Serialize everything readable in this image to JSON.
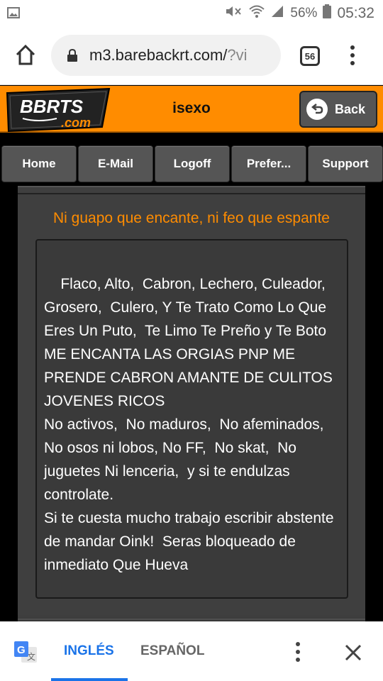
{
  "status_bar": {
    "battery": "56%",
    "time": "05:32",
    "icons": [
      "image-icon",
      "mute-icon",
      "wifi-icon",
      "signal-icon",
      "battery-icon"
    ]
  },
  "browser": {
    "url_main": "m3.barebackrt.com/",
    "url_dim": "?vi",
    "tab_count": "56"
  },
  "site": {
    "logo_text_top": "BBRTS",
    "logo_text_bottom": ".com",
    "page_title": "isexo",
    "back_label": "Back",
    "accent_color": "#ff8c00"
  },
  "nav": {
    "items": [
      {
        "label": "Home"
      },
      {
        "label": "E-Mail"
      },
      {
        "label": "Logoff"
      },
      {
        "label": "Prefer..."
      },
      {
        "label": "Support"
      }
    ]
  },
  "profile": {
    "headline": "Ni guapo que encante, ni feo que espante",
    "text": "Flaco, Alto,  Cabron, Lechero, Culeador, Grosero,  Culero, Y Te Trato Como Lo Que Eres Un Puto,  Te Limo Te Preño y Te Boto\nME ENCANTA LAS ORGIAS PNP ME PRENDE CABRON AMANTE DE CULITOS JOVENES RICOS\nNo activos,  No maduros,  No afeminados,  No osos ni lobos, No FF,  No skat,  No juguetes Ni lenceria,  y si te endulzas controlate.\nSi te cuesta mucho trabajo escribir abstente de mandar Oink!  Seras bloqueado de inmediato Que Hueva"
  },
  "translate_bar": {
    "lang_from": "INGLÉS",
    "lang_to": "ESPAÑOL"
  }
}
